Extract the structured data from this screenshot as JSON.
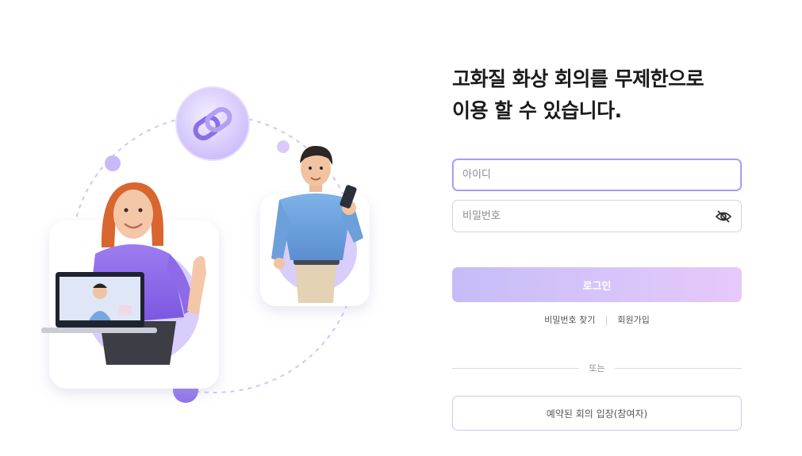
{
  "login": {
    "headline_line1": "고화질 화상 회의를 무제한으로",
    "headline_line2": "이용 할 수 있습니다.",
    "id_placeholder": "아이디",
    "password_placeholder": "비밀번호",
    "login_button": "로그인",
    "find_password": "비밀번호 찾기",
    "signup": "회원가입",
    "or_label": "또는",
    "reserved_meeting_button": "예약된 회의 입장(참여자)"
  },
  "colors": {
    "accent": "#9b8af2",
    "button_gradient_start": "#c7bcf7",
    "button_gradient_end": "#e7c8fb"
  },
  "icons": {
    "password_toggle": "eye-off-icon",
    "link": "chain-link-icon"
  }
}
